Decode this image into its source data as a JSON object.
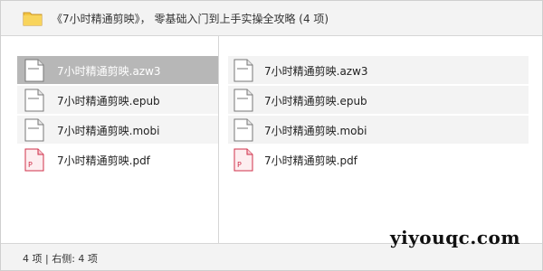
{
  "title": "《7小时精通剪映》， 零基础入门到上手实操全攻略 (4 项)",
  "left_pane": {
    "files": [
      {
        "name": "7小时精通剪映.azw3",
        "icon": "document-icon",
        "selected": true
      },
      {
        "name": "7小时精通剪映.epub",
        "icon": "document-icon",
        "selected": false
      },
      {
        "name": "7小时精通剪映.mobi",
        "icon": "document-icon",
        "selected": false
      },
      {
        "name": "7小时精通剪映.pdf",
        "icon": "pdf-icon",
        "selected": false
      }
    ]
  },
  "right_pane": {
    "files": [
      {
        "name": "7小时精通剪映.azw3",
        "icon": "document-icon"
      },
      {
        "name": "7小时精通剪映.epub",
        "icon": "document-icon"
      },
      {
        "name": "7小时精通剪映.mobi",
        "icon": "document-icon"
      },
      {
        "name": "7小时精通剪映.pdf",
        "icon": "pdf-icon"
      }
    ]
  },
  "status": "4 项 | 右侧: 4 项",
  "watermark": "yiyouqc.com",
  "colors": {
    "selection": "#b7b7b7",
    "bar_background": "#f3f3f3",
    "pdf_accent": "#d0304a"
  }
}
